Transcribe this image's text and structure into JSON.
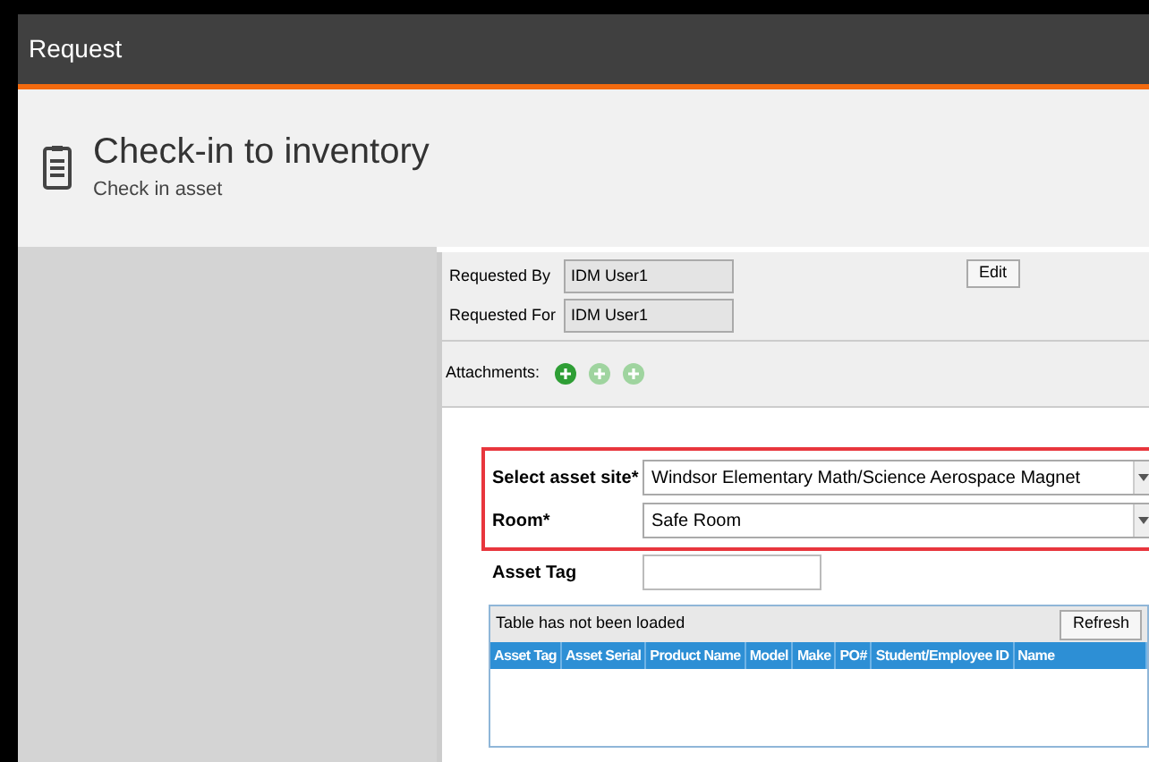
{
  "window": {
    "title": "Request"
  },
  "header": {
    "title": "Check-in to inventory",
    "subtitle": "Check in asset"
  },
  "request_info": {
    "fields": [
      {
        "label": "Requested By",
        "value": "IDM User1"
      },
      {
        "label": "Requested For",
        "value": "IDM User1"
      }
    ],
    "edit_button": "Edit"
  },
  "attachments": {
    "label": "Attachments:",
    "buttons": [
      {
        "disabled": false
      },
      {
        "disabled": true
      },
      {
        "disabled": true
      }
    ]
  },
  "form": {
    "fields": [
      {
        "label": "Select asset site*",
        "value": "Windsor Elementary Math/Science Aerospace Magnet",
        "kind": "select",
        "highlighted": true
      },
      {
        "label": "Room*",
        "value": "Safe Room",
        "kind": "select",
        "highlighted": true
      },
      {
        "label": "Asset Tag",
        "kind": "text",
        "highlighted": false
      }
    ]
  },
  "table": {
    "status": "Table has not been loaded",
    "refresh_button": "Refresh",
    "columns": [
      "Asset Tag",
      "Asset Serial",
      "Product Name",
      "Model",
      "Make",
      "PO#",
      "Student/Employee ID",
      "Name"
    ]
  }
}
